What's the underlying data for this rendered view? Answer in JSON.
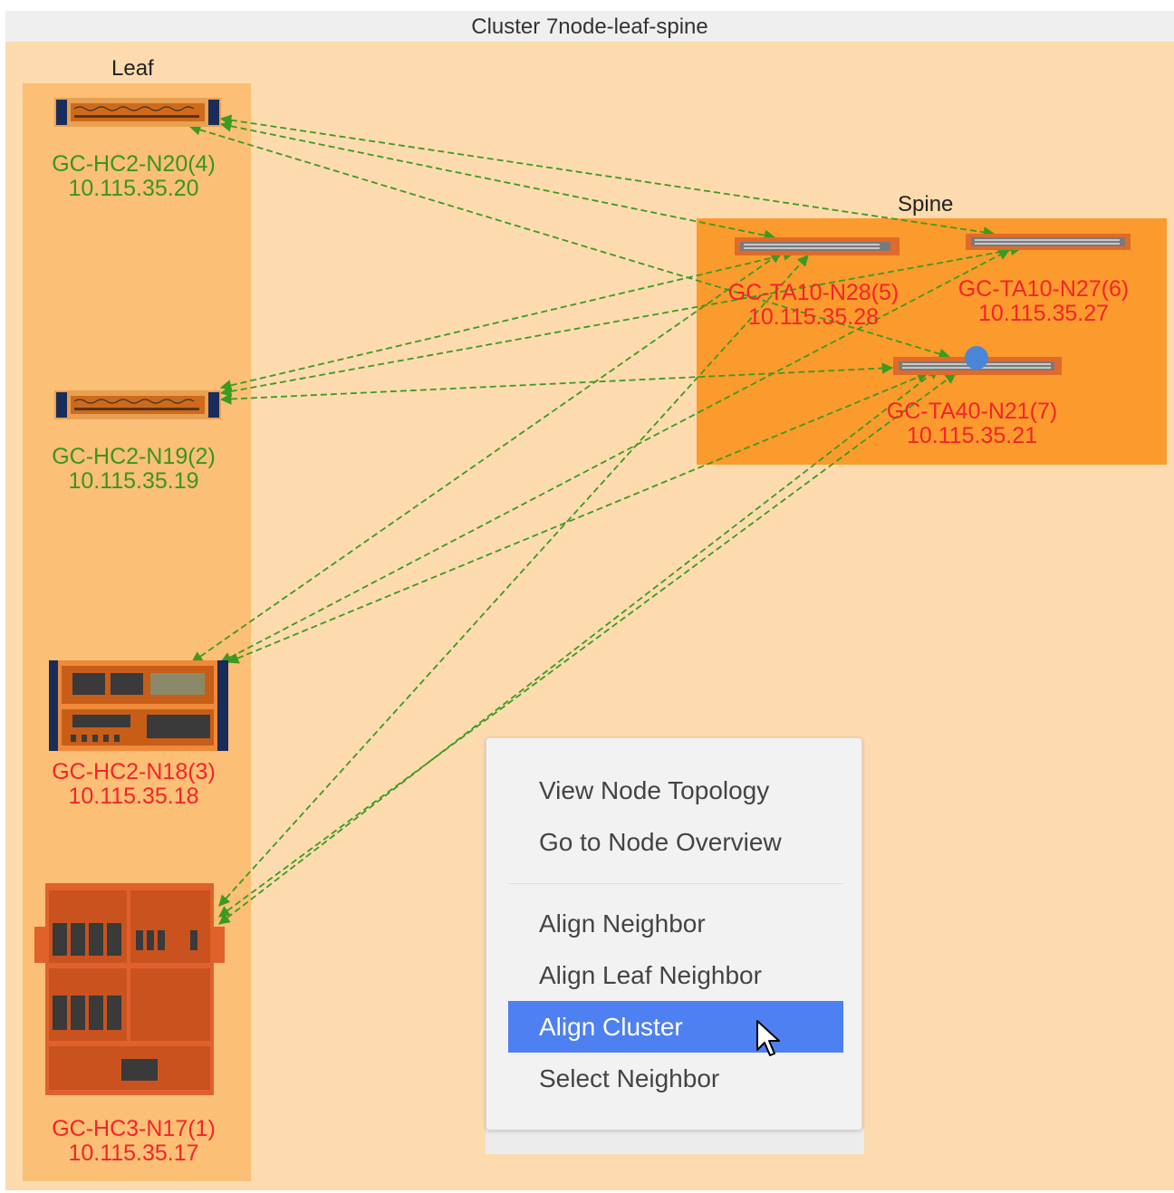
{
  "cluster": {
    "title": "Cluster 7node-leaf-spine",
    "leaf_label": "Leaf",
    "spine_label": "Spine"
  },
  "colors": {
    "ok": "#38961f",
    "alarm": "#f4242a",
    "link": "#3c9a20",
    "menu_highlight": "#4e80f1"
  },
  "nodes": {
    "n20": {
      "name": "GC-HC2-N20(4)",
      "ip": "10.115.35.20",
      "status": "ok"
    },
    "n19": {
      "name": "GC-HC2-N19(2)",
      "ip": "10.115.35.19",
      "status": "ok"
    },
    "n18": {
      "name": "GC-HC2-N18(3)",
      "ip": "10.115.35.18",
      "status": "alarm"
    },
    "n17": {
      "name": "GC-HC3-N17(1)",
      "ip": "10.115.35.17",
      "status": "alarm"
    },
    "n28": {
      "name": "GC-TA10-N28(5)",
      "ip": "10.115.35.28",
      "status": "alarm"
    },
    "n27": {
      "name": "GC-TA10-N27(6)",
      "ip": "10.115.35.27",
      "status": "alarm"
    },
    "n21": {
      "name": "GC-TA40-N21(7)",
      "ip": "10.115.35.21",
      "status": "alarm"
    }
  },
  "context_menu": {
    "view_topology": "View Node Topology",
    "node_overview": "Go to Node Overview",
    "align_neighbor": "Align Neighbor",
    "align_leaf_neighbor": "Align Leaf Neighbor",
    "align_cluster": "Align Cluster",
    "select_neighbor": "Select Neighbor",
    "highlighted": "Align Cluster"
  }
}
